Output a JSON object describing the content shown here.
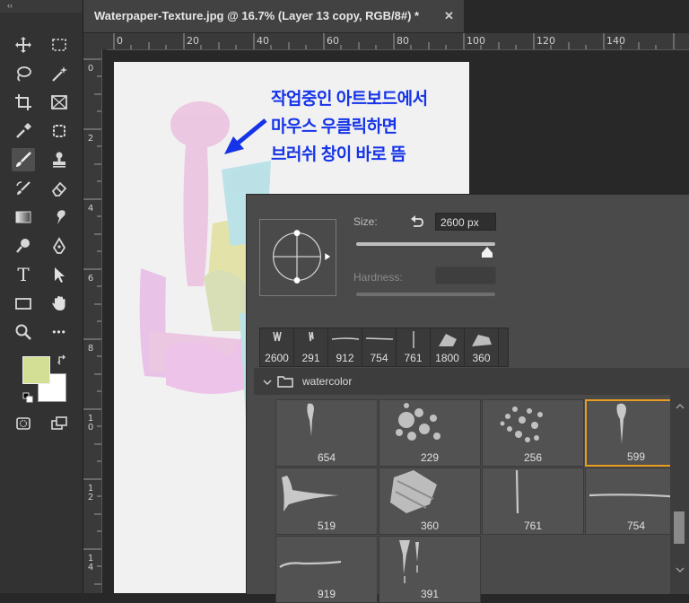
{
  "toolbar": {
    "collapse_glyph": "‹‹",
    "tools": [
      {
        "name": "move-tool",
        "icon": "move-icon"
      },
      {
        "name": "marquee-tool",
        "icon": "rect-marquee-icon"
      },
      {
        "name": "lasso-tool",
        "icon": "lasso-icon"
      },
      {
        "name": "magic-wand-tool",
        "icon": "magic-wand-icon"
      },
      {
        "name": "crop-tool",
        "icon": "crop-icon"
      },
      {
        "name": "frame-tool",
        "icon": "frame-icon"
      },
      {
        "name": "eyedropper-tool",
        "icon": "eyedropper-icon"
      },
      {
        "name": "healing-tool",
        "icon": "patch-icon"
      },
      {
        "name": "brush-tool",
        "icon": "brush-icon"
      },
      {
        "name": "stamp-tool",
        "icon": "stamp-icon"
      },
      {
        "name": "history-brush-tool",
        "icon": "history-brush-icon"
      },
      {
        "name": "eraser-tool",
        "icon": "eraser-icon"
      },
      {
        "name": "gradient-tool",
        "icon": "gradient-icon"
      },
      {
        "name": "smudge-tool",
        "icon": "smudge-icon"
      },
      {
        "name": "dodge-tool",
        "icon": "dodge-icon"
      },
      {
        "name": "pen-tool",
        "icon": "pen-icon"
      },
      {
        "name": "type-tool",
        "icon": "type-icon"
      },
      {
        "name": "path-select-tool",
        "icon": "arrow-icon"
      },
      {
        "name": "shape-tool",
        "icon": "rectangle-icon"
      },
      {
        "name": "hand-tool",
        "icon": "hand-icon"
      },
      {
        "name": "zoom-tool",
        "icon": "zoom-icon"
      },
      {
        "name": "more-tools",
        "icon": "ellipsis-icon"
      }
    ],
    "type_glyph": "T",
    "more_glyph": "•••",
    "foreground_color": "#d4df96",
    "background_color": "#ffffff"
  },
  "document": {
    "tab_title": "Waterpaper-Texture.jpg @ 16.7% (Layer 13 copy, RGB/8#) *",
    "close_glyph": "✕"
  },
  "ruler": {
    "top_labels": [
      "0",
      "20",
      "40",
      "60",
      "80",
      "100",
      "120",
      "140"
    ],
    "left_labels": [
      "0",
      "2",
      "4",
      "6",
      "8",
      "10",
      "12",
      "14"
    ]
  },
  "annotation": {
    "line1": "작업중인 아트보드에서",
    "line2": "마우스 우클릭하면",
    "line3": "브러쉬 창이 바로 뜸",
    "color": "#1533e8"
  },
  "brush_panel": {
    "size_label": "Size:",
    "size_value": "2600 px",
    "size_fraction": 0.94,
    "hardness_label": "Hardness:",
    "recent_brushes": [
      "2600",
      "291",
      "912",
      "754",
      "761",
      "1800",
      "360"
    ],
    "folder_name": "watercolor",
    "brushes": [
      "654",
      "229",
      "256",
      "599",
      "519",
      "360",
      "761",
      "754",
      "919",
      "391"
    ],
    "selected_brush": "599",
    "accent_color": "#e89d1f"
  }
}
